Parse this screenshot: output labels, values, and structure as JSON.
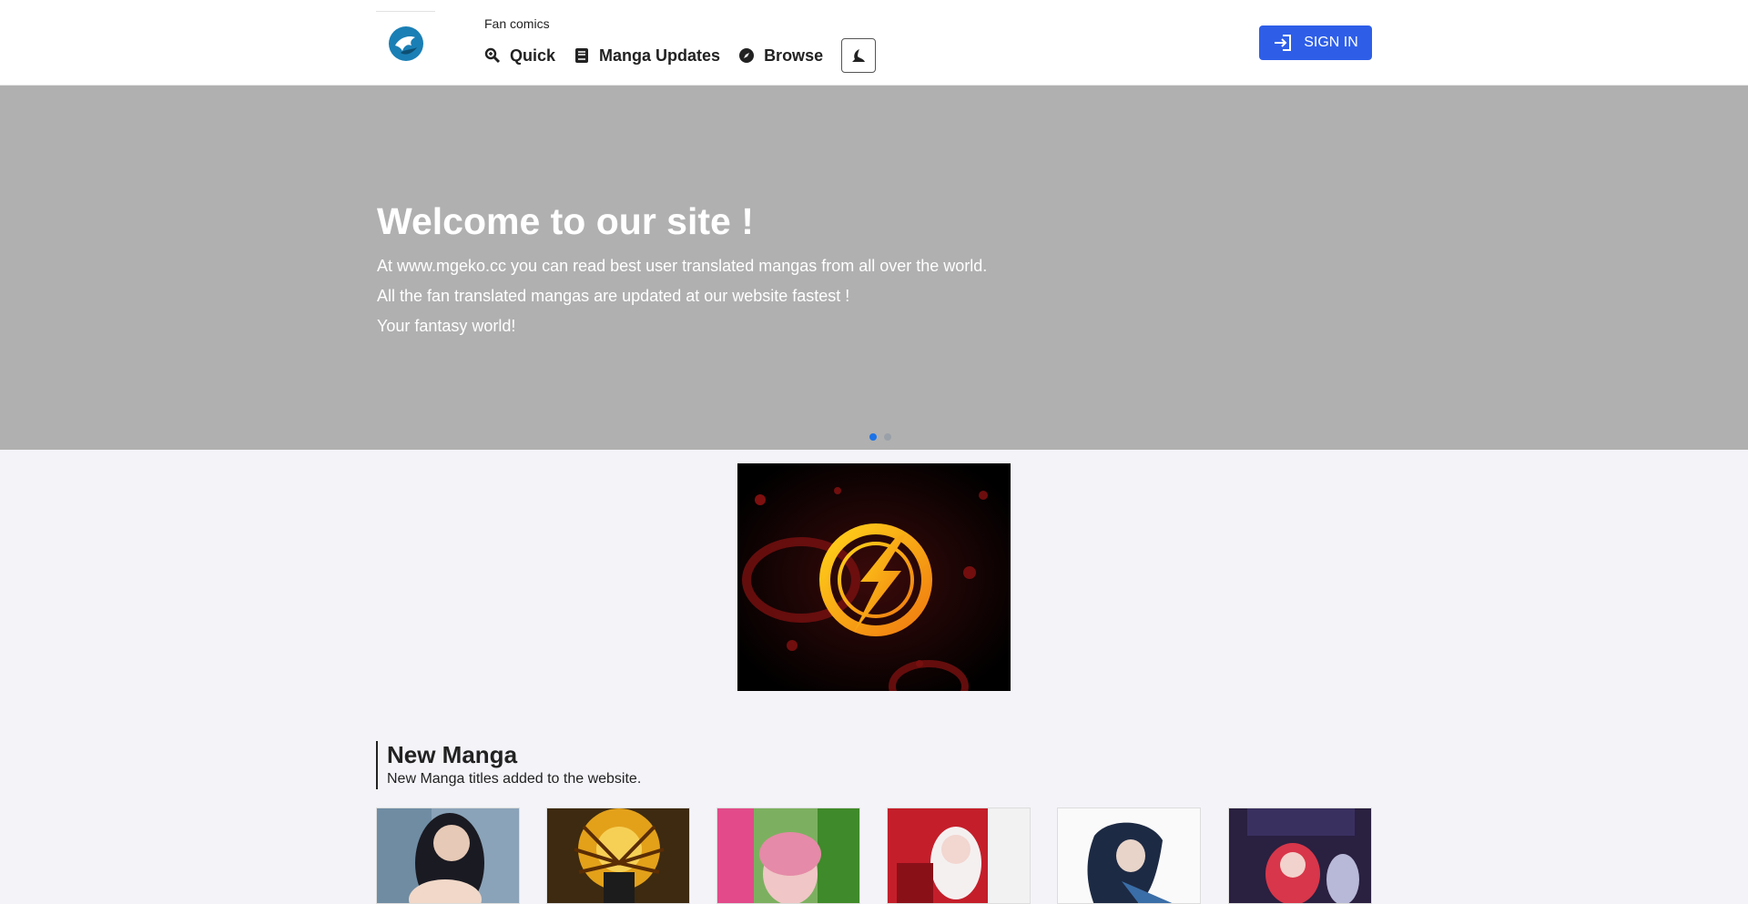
{
  "header": {
    "tagline": "Fan comics",
    "nav": [
      {
        "label": "Quick",
        "icon": "search-icon"
      },
      {
        "label": "Manga Updates",
        "icon": "book-icon"
      },
      {
        "label": "Browse",
        "icon": "compass-icon"
      }
    ],
    "theme_toggle_icon": "moon-icon",
    "signin_label": "SIGN IN",
    "accent": "#2e5ee8"
  },
  "hero": {
    "title": "Welcome to our site !",
    "lines": [
      "At www.mgeko.cc you can read best user translated mangas from all over the world.",
      "All the fan translated mangas are updated at our website fastest !",
      "Your fantasy world!"
    ],
    "slides": 2,
    "active_slide": 1
  },
  "new_manga": {
    "title": "New Manga",
    "subtitle": "New Manga titles added to the website."
  }
}
